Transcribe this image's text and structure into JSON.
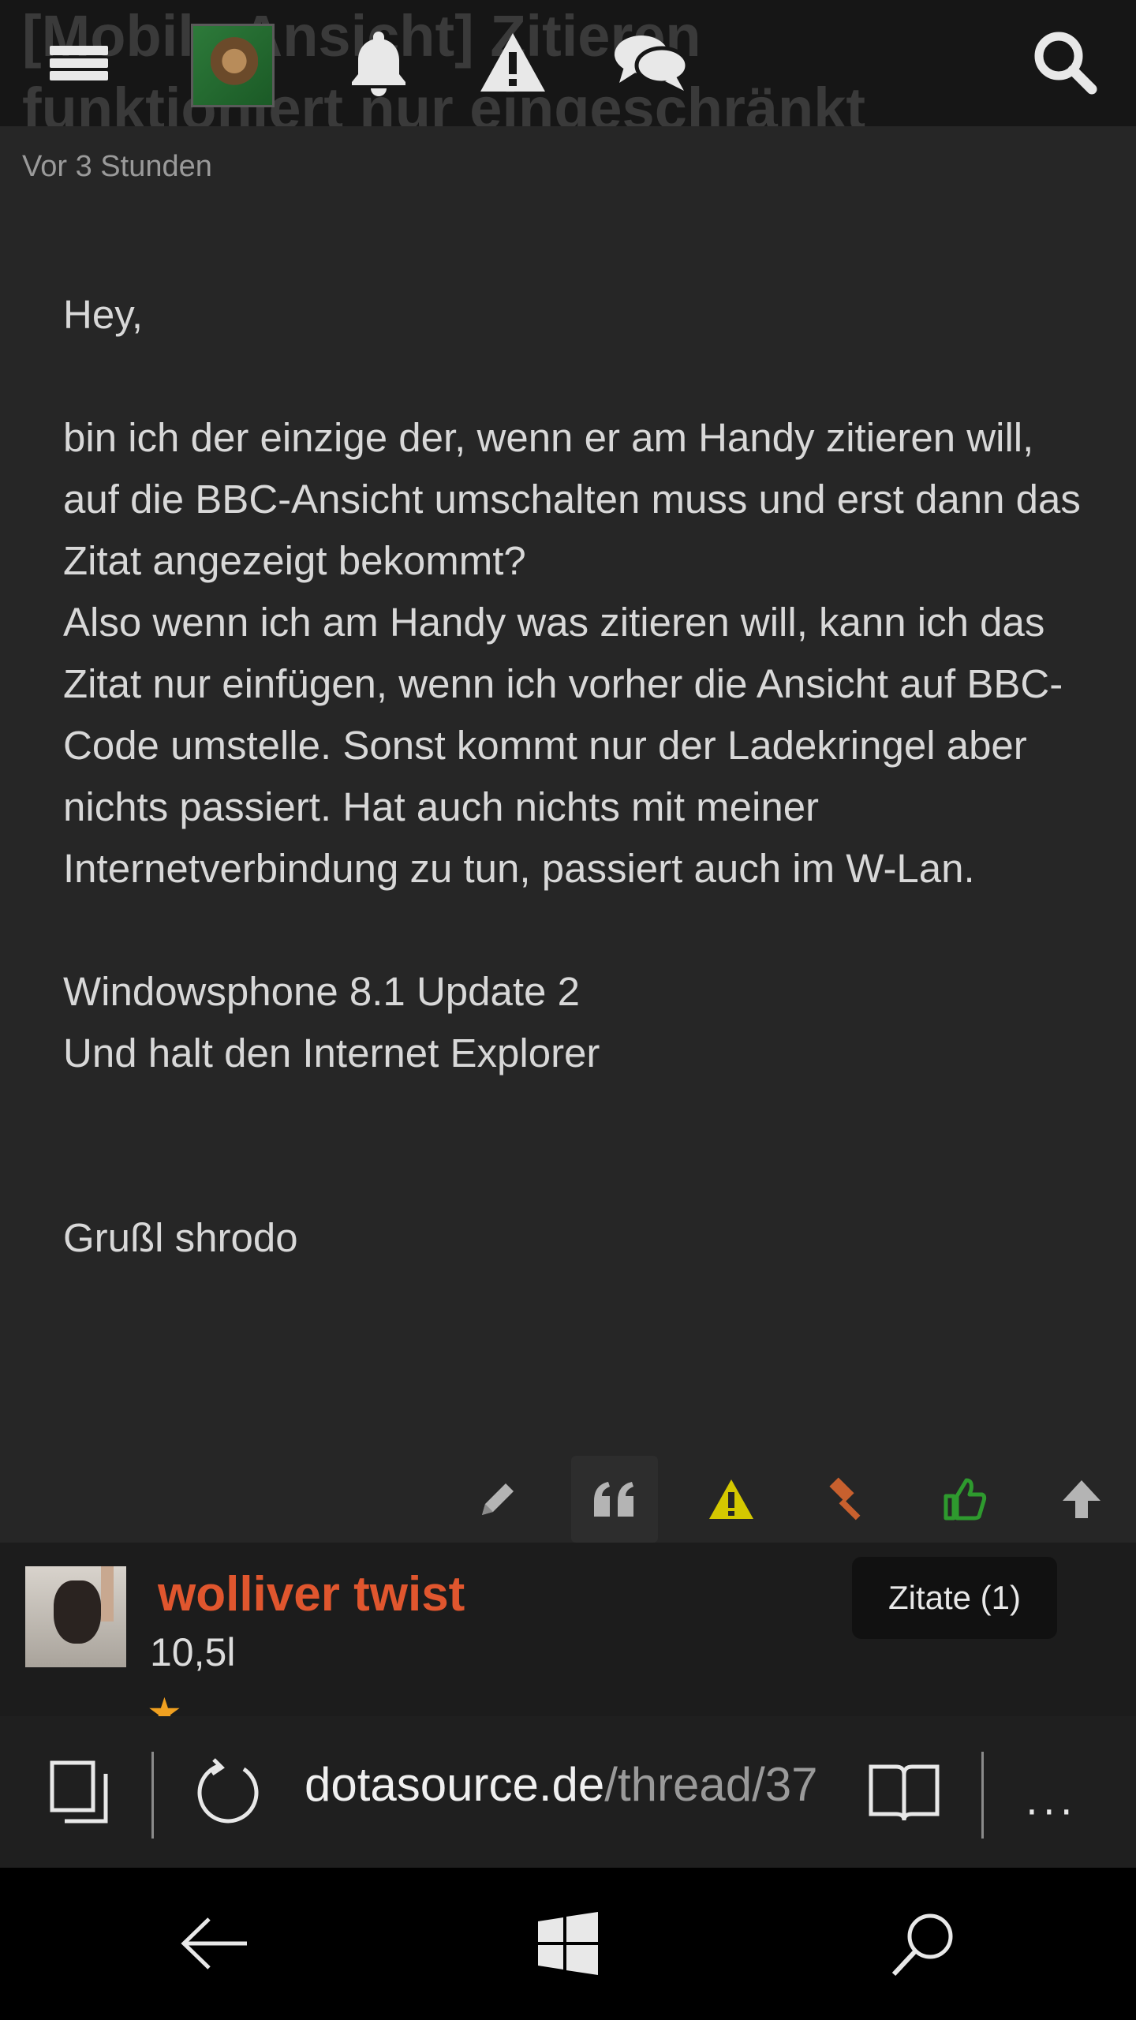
{
  "header": {
    "thread_title": "[Mobile Ansicht] Zitieren funktioniert nur eingeschränkt",
    "icons": [
      "menu-icon",
      "avatar",
      "bell-icon",
      "warning-icon",
      "chat-icon",
      "search-icon"
    ]
  },
  "post": {
    "time": "Vor 3 Stunden",
    "body": "Hey,\n\nbin ich der einzige der, wenn er am Handy zitieren will, auf die BBC-Ansicht umschalten muss und erst dann das Zitat angezeigt bekommt?\nAlso wenn ich am Handy was zitieren will, kann ich das Zitat nur einfügen, wenn ich vorher die Ansicht auf BBC-Code umstelle. Sonst kommt nur der Ladekringel aber nichts passiert. Hat auch nichts mit meiner Internetverbindung zu tun, passiert auch im W-Lan.\n\nWindowsphone 8.1 Update 2\nUnd halt den Internet Explorer\n\n\nGrußl shrodo",
    "actions": [
      "edit-icon",
      "quote-icon",
      "report-icon",
      "moderate-icon",
      "like-icon",
      "up-icon"
    ],
    "colors": {
      "report": "#d4c800",
      "moderate": "#c8602e",
      "like": "#2e9a2e",
      "default": "#b4b4b4"
    }
  },
  "next_post": {
    "username": "wolliver twist",
    "stat": "10,5l",
    "quotes_label": "Zitate (1)",
    "username_color": "#e0562e"
  },
  "browser": {
    "url_host": "dotasource.de",
    "url_path": "/thread/37",
    "more_label": "···"
  }
}
